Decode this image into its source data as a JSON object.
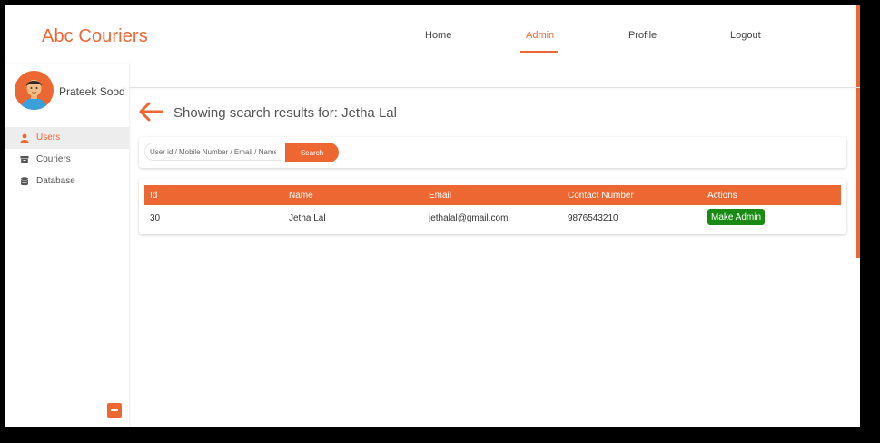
{
  "header": {
    "brand": "Abc Couriers",
    "nav": [
      {
        "label": "Home",
        "active": false
      },
      {
        "label": "Admin",
        "active": true
      },
      {
        "label": "Profile",
        "active": false
      },
      {
        "label": "Logout",
        "active": false
      }
    ]
  },
  "sidebar": {
    "user_name": "Prateek Sood",
    "items": [
      {
        "label": "Users",
        "icon": "user-icon",
        "active": true
      },
      {
        "label": "Couriers",
        "icon": "box-icon",
        "active": false
      },
      {
        "label": "Database",
        "icon": "database-icon",
        "active": false
      }
    ],
    "collapse_icon": "minus-icon"
  },
  "main": {
    "back_icon": "arrow-left-icon",
    "results_title": "Showing search results for: Jetha Lal",
    "search": {
      "placeholder": "User id / Mobile Number / Email / Name",
      "value": "",
      "button_label": "Search"
    },
    "table": {
      "columns": [
        "Id",
        "Name",
        "Email",
        "Contact Number",
        "Actions"
      ],
      "rows": [
        {
          "id": "30",
          "name": "Jetha Lal",
          "email": "jethalal@gmail.com",
          "contact": "9876543210",
          "action": "Make Admin"
        }
      ]
    }
  },
  "colors": {
    "accent": "#ed6733",
    "action_button": "#1a8a14",
    "sidebar_active_bg": "#ededed"
  }
}
